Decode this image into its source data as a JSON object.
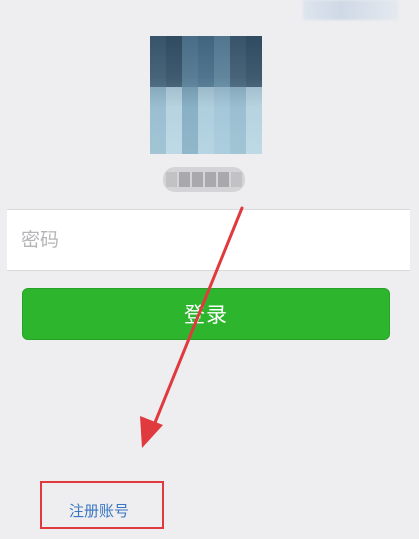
{
  "password": {
    "placeholder": "密码",
    "value": ""
  },
  "login_button": {
    "label": "登录"
  },
  "register_link": {
    "label": "注册账号"
  },
  "colors": {
    "login_green": "#2db52d",
    "link_blue": "#3a76c2",
    "annotation_red": "#e0393e",
    "background": "#eeeef0"
  },
  "icons": {
    "avatar": "avatar-blurred",
    "annotation_arrow": "arrow-icon"
  }
}
